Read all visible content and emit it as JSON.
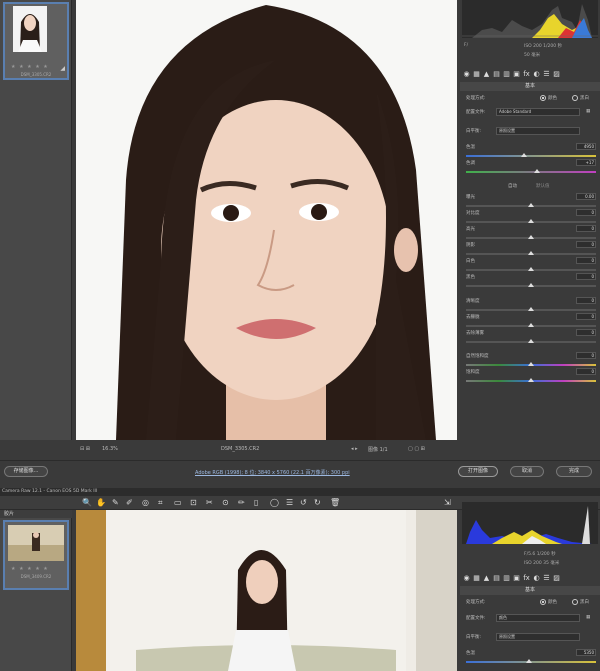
{
  "top_window": {
    "filmstrip": {
      "thumb_stars": "★ ★ ★ ★ ★",
      "thumb_filename": "DSM_3305.CR2"
    },
    "meta": {
      "line1_left": "F/",
      "line1_right": "ISO 200  1/200 秒",
      "line2_right": "50 毫米"
    },
    "panel_title": "基本",
    "treatment_label": "处理方式:",
    "treatment_color": "颜色",
    "treatment_bw": "黑白",
    "profile_label": "配置文件:",
    "profile_value": "Adobe Standard",
    "wb_label": "白平衡:",
    "wb_value": "原照设置",
    "temp_label": "色温",
    "temp_value": "4950",
    "tint_label": "色调",
    "tint_value": "+17",
    "auto_label": "自动",
    "default_label": "默认值",
    "exposure_label": "曝光",
    "exposure_value": "0.00",
    "contrast_label": "对比度",
    "contrast_value": "0",
    "highlights_label": "高光",
    "highlights_value": "0",
    "shadows_label": "阴影",
    "shadows_value": "0",
    "whites_label": "白色",
    "whites_value": "0",
    "blacks_label": "黑色",
    "blacks_value": "0",
    "clarity_label": "清晰度",
    "clarity_value": "0",
    "texture_label": "去朦胧",
    "texture_value": "0",
    "dehaze_label": "去除薄雾",
    "dehaze_value": "0",
    "vibrance_label": "自然饱和度",
    "vibrance_value": "0",
    "saturation_label": "饱和度",
    "saturation_value": "0",
    "status": {
      "zoom": "16.3%",
      "filename": "DSM_3305.CR2",
      "page": "图像 1/1"
    },
    "footer": {
      "save_button": "存储图像...",
      "workflow_info": "Adobe RGB (1998); 8 位; 3840 x 5760 (22.1 百万像素); 300 ppi",
      "open_button": "打开图像",
      "cancel_button": "取消",
      "done_button": "完成"
    }
  },
  "bottom_window": {
    "titlebar": "Camera Raw 12.1 - Canon EOS 5D Mark III",
    "film_head": "胶片",
    "thumb_stars": "★ ★ ★ ★ ★",
    "thumb_filename": "DSM_3409.CR2",
    "meta_line1": "F/5.6  1/200 秒",
    "meta_line2": "ISO 200  35 毫米",
    "panel_title": "基本",
    "treatment_label": "处理方式:",
    "treatment_color": "颜色",
    "treatment_bw": "黑白",
    "profile_label": "配置文件:",
    "profile_value": "颜色",
    "wb_label": "白平衡:",
    "wb_value": "原照设置",
    "temp_label": "色温",
    "temp_value": "5350"
  }
}
